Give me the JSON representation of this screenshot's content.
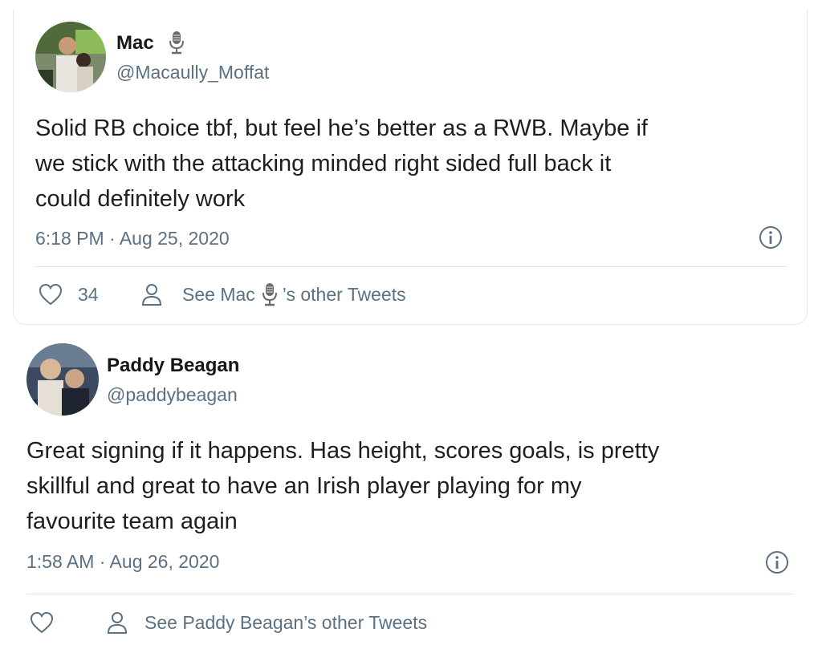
{
  "tweets": [
    {
      "name": "Mac",
      "handle": "@Macaully_Moffat",
      "body_lines": [
        "Solid RB choice tbf, but feel he’s better as a RWB. Maybe if",
        "we stick with the attacking minded right sided full back it",
        "could definitely work"
      ],
      "timestamp": "6:18 PM · Aug 25, 2020",
      "likes": "34",
      "other_tweets_prefix": "See Mac",
      "other_tweets_suffix": "’s other Tweets",
      "name_badge_icon": "microphone-icon"
    },
    {
      "name": "Paddy Beagan",
      "handle": "@paddybeagan",
      "body_lines": [
        "Great signing if it happens. Has height, scores goals, is pretty",
        "skillful and great to have an Irish player playing for my",
        "favourite team again"
      ],
      "timestamp": "1:58 AM · Aug 26, 2020",
      "likes": "",
      "other_tweets_label": "See Paddy Beagan’s other Tweets"
    }
  ],
  "colors": {
    "secondary_text": "#5b7083",
    "divider": "#dfe4e8",
    "primary_text": "#0f1419"
  }
}
